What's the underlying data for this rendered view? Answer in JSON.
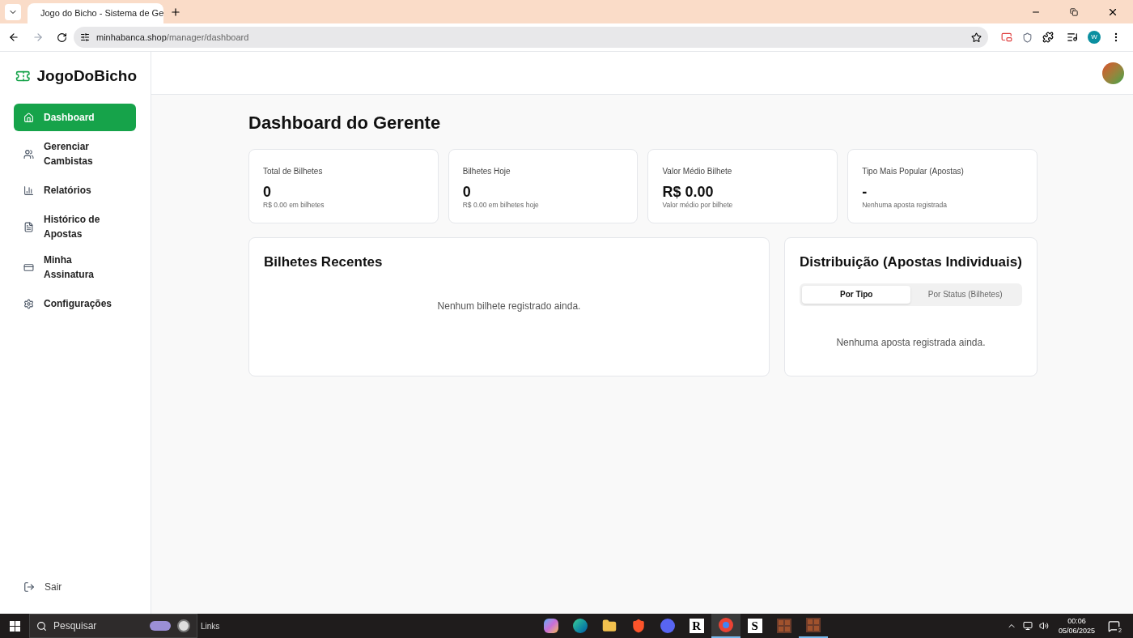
{
  "browser": {
    "tab": {
      "title": "Jogo do Bicho - Sistema de Ge"
    },
    "url_host": "minhabanca.shop",
    "url_path": "/manager/dashboard",
    "profile": "W"
  },
  "sidebar": {
    "brand": "JogoDoBicho",
    "items": [
      {
        "label": "Dashboard",
        "selected": true
      },
      {
        "label": "Gerenciar Cambistas",
        "selected": false
      },
      {
        "label": "Relatórios",
        "selected": false
      },
      {
        "label": "Histórico de Apostas",
        "selected": false
      },
      {
        "label": "Minha Assinatura",
        "selected": false
      },
      {
        "label": "Configurações",
        "selected": false
      }
    ],
    "logout": "Sair"
  },
  "page": {
    "title": "Dashboard do Gerente",
    "stats": [
      {
        "label": "Total de Bilhetes",
        "value": "0",
        "note": "R$ 0.00 em bilhetes"
      },
      {
        "label": "Bilhetes Hoje",
        "value": "0",
        "note": "R$ 0.00 em bilhetes hoje"
      },
      {
        "label": "Valor Médio Bilhete",
        "value": "R$ 0.00",
        "note": "Valor médio por bilhete"
      },
      {
        "label": "Tipo Mais Popular (Apostas)",
        "value": "-",
        "note": "Nenhuma aposta registrada"
      }
    ],
    "recent": {
      "title": "Bilhetes Recentes",
      "empty": "Nenhum bilhete registrado ainda."
    },
    "distribution": {
      "title": "Distribuição (Apostas Individuais)",
      "tabs": [
        {
          "label": "Por Tipo",
          "selected": true
        },
        {
          "label": "Por Status (Bilhetes)",
          "selected": false
        }
      ],
      "empty": "Nenhuma aposta registrada ainda."
    }
  },
  "taskbar": {
    "search": "Pesquisar",
    "links": "Links",
    "apps": [
      {
        "kind": "copilot",
        "running": false
      },
      {
        "kind": "edge",
        "running": false
      },
      {
        "kind": "folder",
        "running": false
      },
      {
        "kind": "brave",
        "running": false
      },
      {
        "kind": "discord",
        "running": false
      },
      {
        "kind": "glyph",
        "glyph": "R",
        "running": false
      },
      {
        "kind": "chrome",
        "running": true
      },
      {
        "kind": "glyph",
        "glyph": "S",
        "running": false
      },
      {
        "kind": "grid",
        "running": false
      },
      {
        "kind": "grid",
        "running": true
      }
    ],
    "time": "00:06",
    "date": "05/06/2025",
    "notifications": "2"
  }
}
